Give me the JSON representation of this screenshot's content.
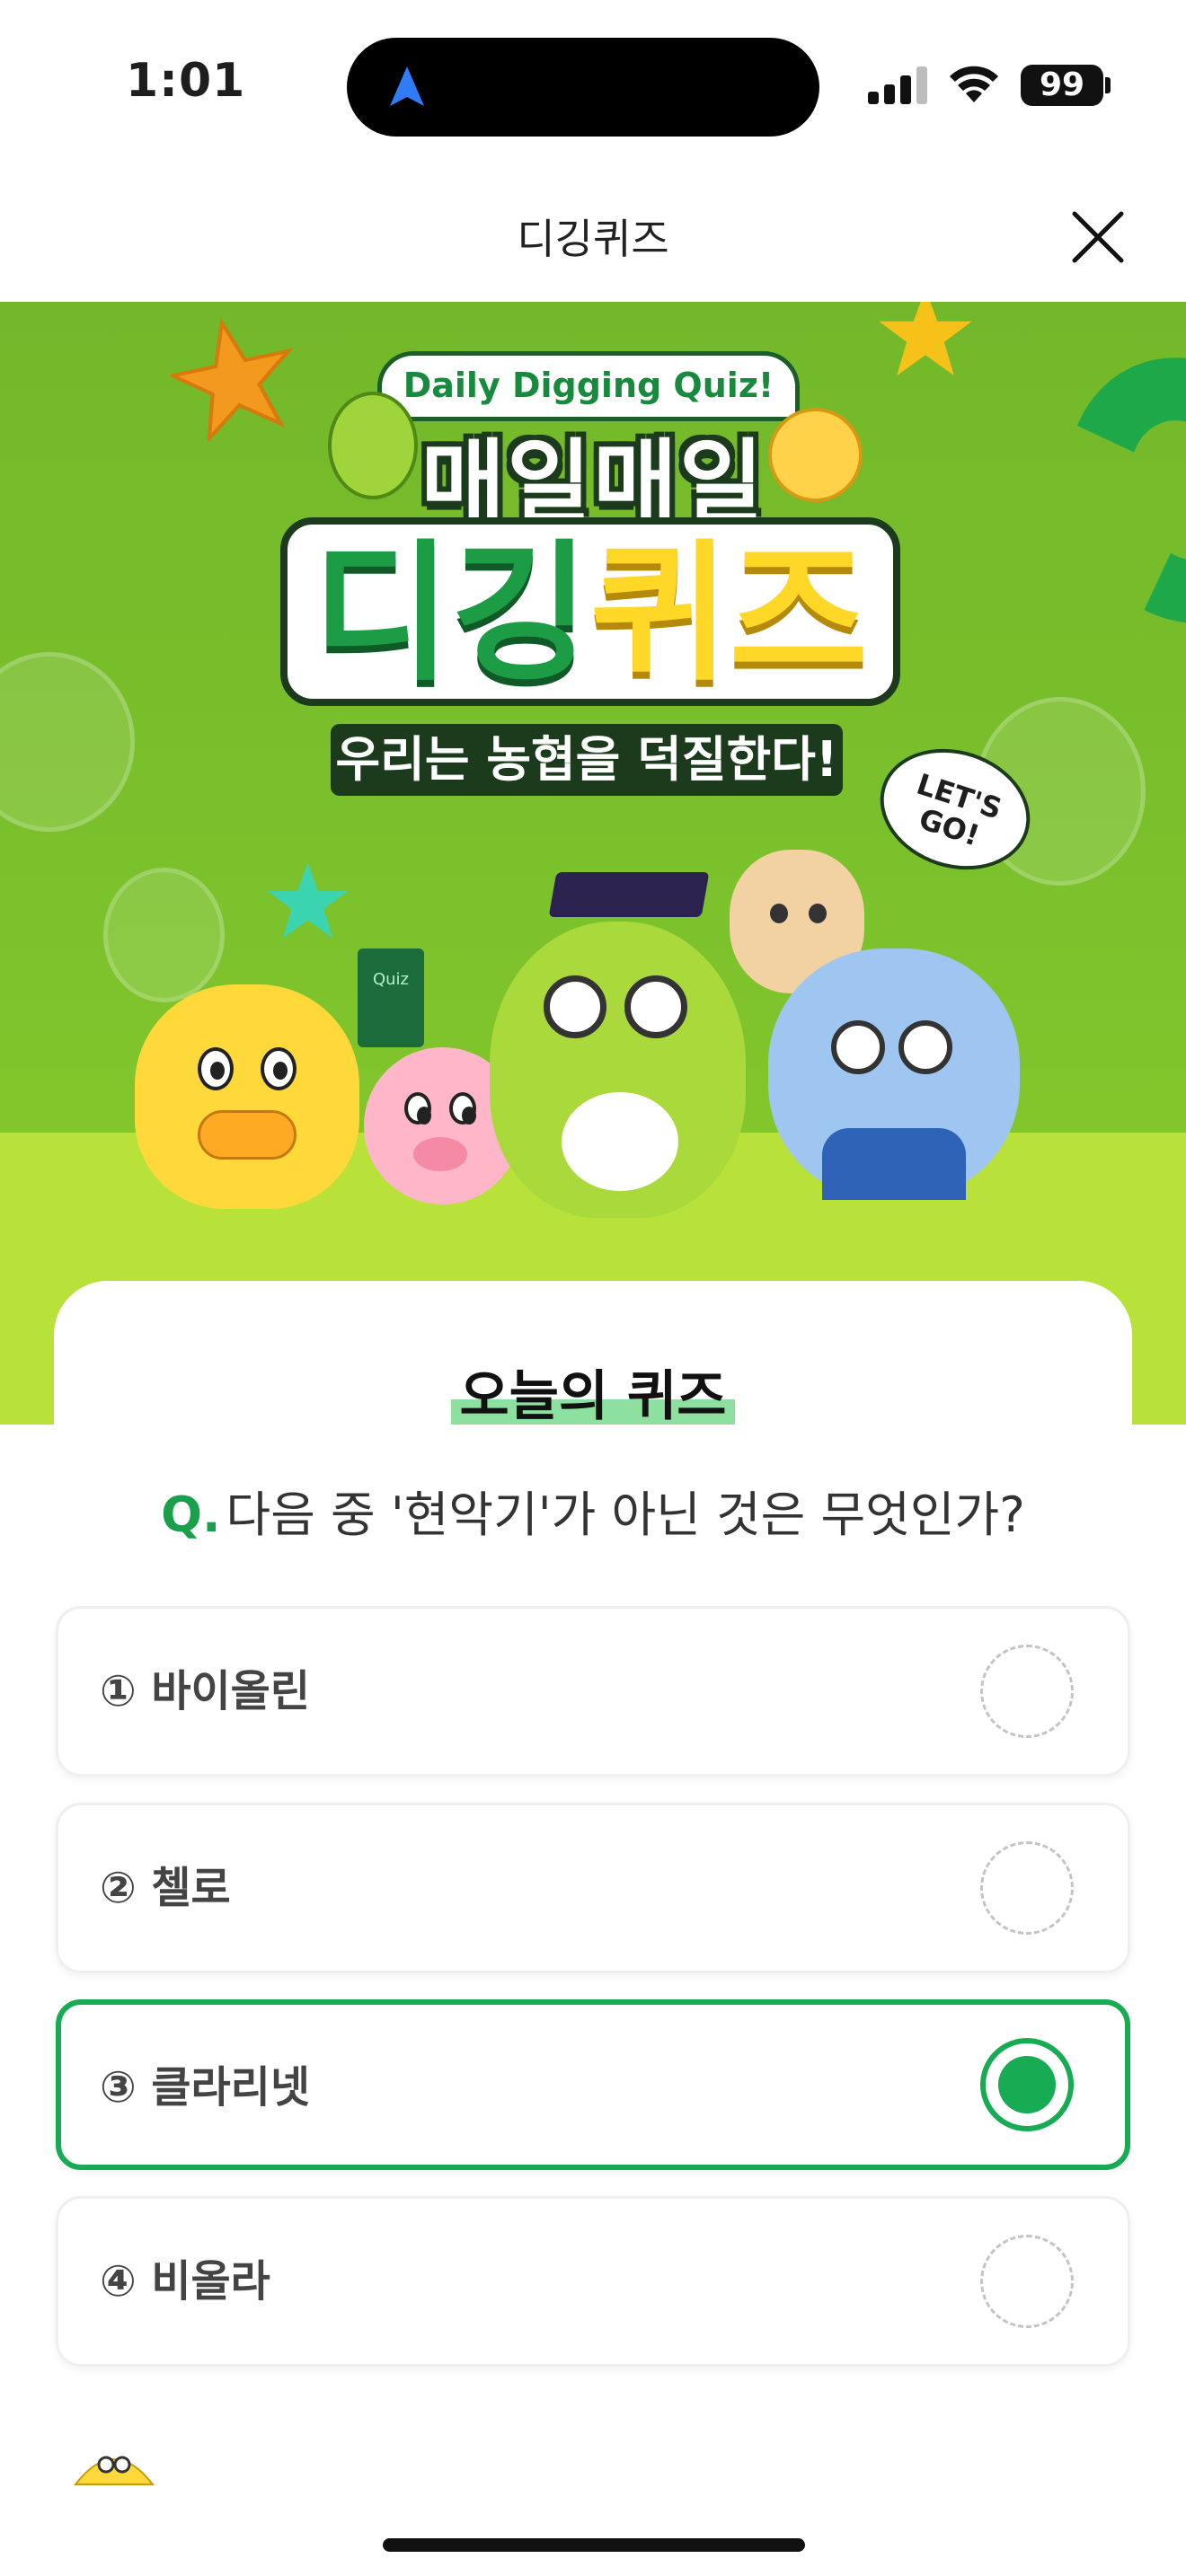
{
  "status_bar": {
    "time": "1:01",
    "battery": "99"
  },
  "header": {
    "title": "디깅퀴즈"
  },
  "banner": {
    "sticker": "Daily Digging Quiz!",
    "title_top": "매일매일",
    "title_main_green": "디깅",
    "title_main_yellow": "퀴즈",
    "slogan": "우리는 농협을 덕질한다!",
    "bubble": "LET'S GO!",
    "book_label": "Quiz"
  },
  "quiz": {
    "heading": "오늘의 퀴즈",
    "question_prefix": "Q.",
    "question": "다음 중 '현악기'가 아닌 것은 무엇인가?",
    "options": [
      {
        "label": "① 바이올린",
        "selected": false
      },
      {
        "label": "② 첼로",
        "selected": false
      },
      {
        "label": "③ 클라리넷",
        "selected": true
      },
      {
        "label": "④ 비올라",
        "selected": false
      }
    ]
  },
  "colors": {
    "accent": "#17ab53",
    "banner_green": "#7cc22c",
    "banner_floor": "#b8e13a"
  },
  "icons": {
    "close": "close-icon",
    "navigation": "location-arrow-icon",
    "radio_selected": "radio-checked-icon",
    "radio_empty": "radio-empty-icon"
  }
}
